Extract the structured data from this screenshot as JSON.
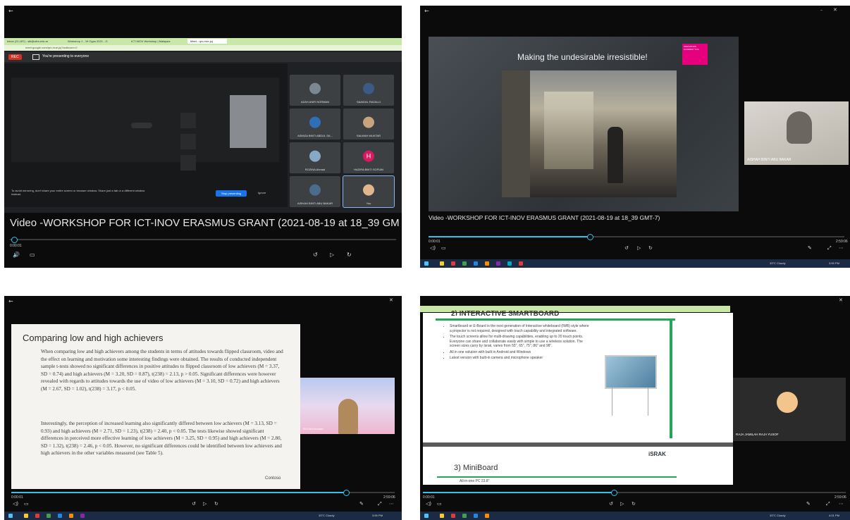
{
  "panel1": {
    "browser_tabs": [
      "Inbox (21,187) - siti@uitm.edu.m",
      "Workshop 1 - 19 Ogos 2021 - G",
      "ICT-INOV Workshop | Malaysia",
      "Meet - qrx-rrue-juj"
    ],
    "address": "meet.google.com/qrx-rrue-juj?authuser=0",
    "rec_label": "REC",
    "presenting_label": "You're presenting to everyone",
    "participants": [
      {
        "name": "AZAH ANIR NORMAN",
        "avatar": "person-photo"
      },
      {
        "name": "SAAIDAL RAZALLI",
        "avatar": "person-photo"
      },
      {
        "name": "ASMIZA BINTI ABDUL SA...",
        "avatar": "person-photo"
      },
      {
        "name": "SALWAH MUKTAR",
        "avatar": "person-photo"
      },
      {
        "name": "ROZINA Ahmad",
        "avatar": "person-photo"
      },
      {
        "name": "HAZIRA BINTI SOFIAN",
        "avatar": "H"
      },
      {
        "name": "AISHAH BINTI ABU BAKAR",
        "avatar": "person-photo"
      },
      {
        "name": "You",
        "avatar": "person-photo"
      }
    ],
    "warning_text": "To avoid mirroring, don't share your entire screen or browser window. Share just a tab or a different window instead.",
    "stop_presenting": "Stop presenting",
    "ignore": "Ignore",
    "video_title": "Video -WORKSHOP FOR ICT-INOV ERASMUS GRANT (2021-08-19 at 18_39 GM",
    "time_elapsed": "0:00:01"
  },
  "panel2": {
    "slide_title": "Making the undesirable irresistible!",
    "logo_text": "INNOVATION ACADEMY TCS",
    "speaker_name": "AISHAH BINTI ABU BAKAR",
    "video_title": "Video -WORKSHOP FOR ICT-INOV ERASMUS GRANT (2021-08-19 at 18_39 GMT-7)",
    "time_elapsed": "0:00:01",
    "time_total": "2:59:06",
    "progress": 0.38,
    "weather": "33°C Cloudy",
    "clock": "3:59 PM"
  },
  "panel3": {
    "slide_title": "Comparing low and high achievers",
    "paragraph1": "When comparing low and high achievers among the students in terms of attitudes towards flipped classroom, video and the effect on learning and motivation some interesting findings were obtained. The results of conducted independent sample t-tests showed no significant differences in positive attitudes to flipped classroom of low achievers (M = 3.37, SD = 0.74) and high achievers (M = 3.20, SD = 0.87), t(238) = 2.13, p > 0.05. Significant differences were however revealed with regards to attitudes towards the use of video of low achievers (M = 3.10, SD = 0.72) and high achievers (M = 2.67, SD = 1.02), t(238) = 3.17, p < 0.05.",
    "paragraph2": "Interestingly, the perception of increased learning also significantly differed between low achievers (M = 3.13, SD = 0.93) and high achievers (M = 2.71, SD = 1.23), t(238) = 2.40, p < 0.05. The tests likewise showed significant differences in perceived more effective learning of low achievers (M = 3.25, SD = 0.95) and high achievers (M = 2.80, SD = 1.32), t(238) = 2.46, p < 0.05. However, no significant differences could be identified between low achievers and high achievers in the other variables measured (see Table 5).",
    "brand": "Contoso",
    "speaker_name": "ROZINA Ahmad",
    "time_elapsed": "0:00:01",
    "time_total": "2:59:06",
    "progress": 0.82,
    "weather": "33°C Cloudy",
    "clock": "3:59 PM"
  },
  "panel4": {
    "section_heading": "2) INTERACTIVE SMARTBOARD",
    "bullets": [
      "Smartboard or E-Board is the next generation of Interactive whiteboard (IWB) style where a projector is not required, designed with touch capability and integrated software.",
      "The touch screens allow for multi-drawing capabilities, enabling up to 20 touch points. Everyone can share and collaborate easily with simple to use a wireless solution. The screen sizes carry by Israk, varies from 55\", 65\", 75\", 86\" and 98\".",
      "All in one solution with built in Android and Windows",
      "Latest version with built-in camera and microphone speaker"
    ],
    "logo": "iSRAK",
    "next_heading": "3) MiniBoard",
    "next_bullet": "All-in-one PC 23.8\"",
    "speaker_name": "RAJA JAMILAH RAJA YUSOF",
    "time_elapsed": "0:00:01",
    "time_total": "2:59:06",
    "progress": 0.45,
    "weather": "33°C Cloudy",
    "clock": "4:01 PM"
  },
  "colors": {
    "accent": "#34c3e8",
    "taskbar": "#1b2b45",
    "meet_bg": "#202124",
    "rec": "#d93025"
  }
}
